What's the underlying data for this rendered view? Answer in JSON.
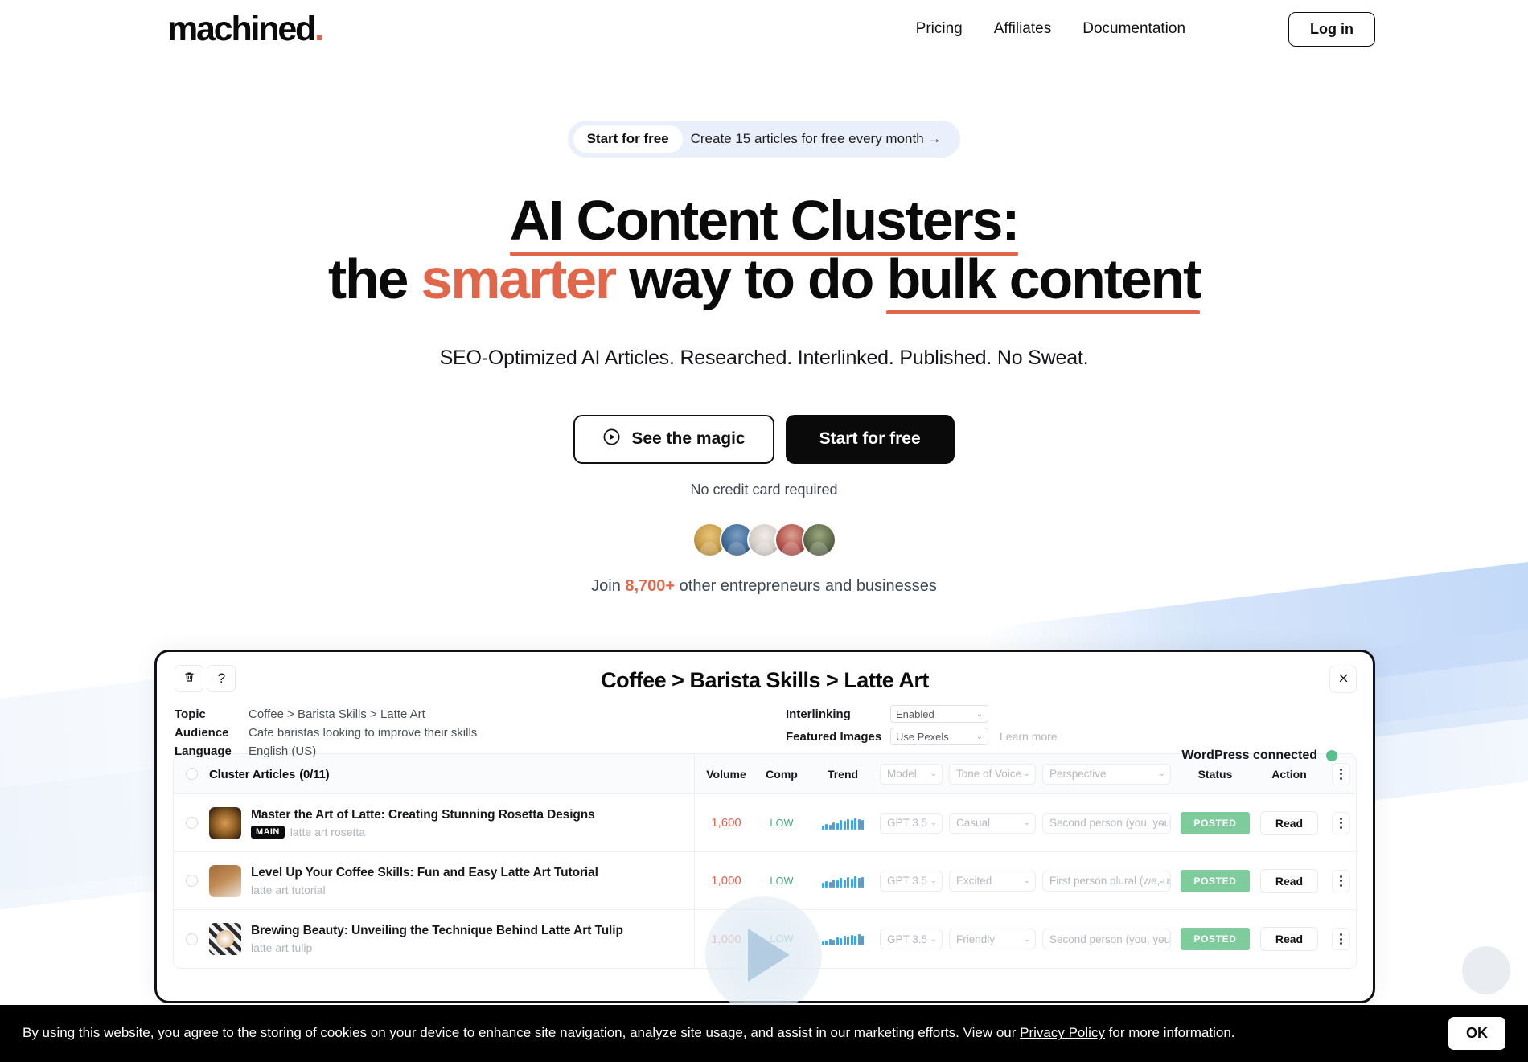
{
  "header": {
    "logo_text": "machined",
    "logo_dot": ".",
    "nav": [
      {
        "label": "Pricing"
      },
      {
        "label": "Affiliates"
      },
      {
        "label": "Documentation"
      }
    ],
    "login_label": "Log in"
  },
  "hero": {
    "announce_badge": "Start for free",
    "announce_text": "Create 15 articles for free every month  →",
    "headline_line1": "AI Content Clusters:",
    "headline_l2_a": "the ",
    "headline_l2_smarter": "smarter",
    "headline_l2_b": " way to do ",
    "headline_l2_c": "bulk content",
    "subhead": "SEO-Optimized AI Articles. Researched. Interlinked. Published. No Sweat.",
    "btn_secondary": "See the magic",
    "btn_primary": "Start for free",
    "no_card": "No credit card required",
    "join_prefix": "Join ",
    "join_count": "8,700+",
    "join_suffix": " other entrepreneurs and businesses"
  },
  "app": {
    "title": "Coffee > Barista Skills > Latte Art",
    "help_label": "?",
    "meta": [
      {
        "key": "Topic",
        "value": "Coffee > Barista Skills > Latte Art"
      },
      {
        "key": "Audience",
        "value": "Cafe baristas looking to improve their skills"
      },
      {
        "key": "Language",
        "value": "English (US)"
      }
    ],
    "settings": [
      {
        "key": "Interlinking",
        "value": "Enabled"
      },
      {
        "key": "Featured Images",
        "value": "Use Pexels"
      }
    ],
    "learn_more": "Learn more",
    "wordpress_status": "WordPress connected",
    "table": {
      "header": {
        "cluster_label": "Cluster Articles",
        "cluster_count": "(0/11)",
        "volume": "Volume",
        "comp": "Comp",
        "trend": "Trend",
        "model": "Model",
        "tone": "Tone of Voice",
        "perspective": "Perspective",
        "status": "Status",
        "action": "Action"
      },
      "rows": [
        {
          "title": "Master the Art of Latte: Creating Stunning Rosetta Designs",
          "badge": "MAIN",
          "keyword": "latte art rosetta",
          "volume": "1,600",
          "comp": "LOW",
          "model": "GPT 3.5",
          "tone": "Casual",
          "perspective": "Second person (you, your)",
          "status": "POSTED",
          "action": "Read"
        },
        {
          "title": "Level Up Your Coffee Skills: Fun and Easy Latte Art Tutorial",
          "badge": "",
          "keyword": "latte art tutorial",
          "volume": "1,000",
          "comp": "LOW",
          "model": "GPT 3.5",
          "tone": "Excited",
          "perspective": "First person plural (we, us)",
          "status": "POSTED",
          "action": "Read"
        },
        {
          "title": "Brewing Beauty: Unveiling the Technique Behind Latte Art Tulip",
          "badge": "",
          "keyword": "latte art tulip",
          "volume": "1,000",
          "comp": "LOW",
          "model": "GPT 3.5",
          "tone": "Friendly",
          "perspective": "Second person (you, your)",
          "status": "POSTED",
          "action": "Read"
        }
      ]
    }
  },
  "cookie": {
    "text_before": "By using this website, you agree to the storing of cookies on your device to enhance site navigation, analyze site usage, and assist in our marketing efforts. View our ",
    "link": "Privacy Policy",
    "text_after": " for more information.",
    "ok_label": "OK"
  },
  "colors": {
    "accent_coral": "#e2674a",
    "status_green": "#7ecb9c",
    "trend_blue": "#41a4e8",
    "volume_red": "#e06353"
  }
}
